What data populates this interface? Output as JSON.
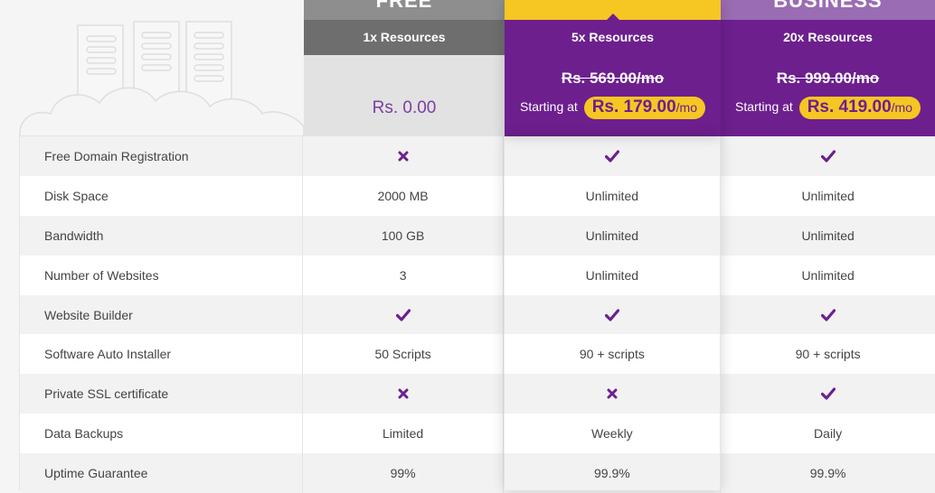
{
  "plans": [
    {
      "title": "FREE",
      "resources": "1x Resources",
      "price": "Rs. 0.00"
    },
    {
      "title": "",
      "resources": "5x Resources",
      "old_price": "Rs. 569.00/mo",
      "starting_label": "Starting at",
      "price": "Rs. 179.00",
      "per": "/mo"
    },
    {
      "title": "BUSINESS",
      "resources": "20x Resources",
      "old_price": "Rs. 999.00/mo",
      "starting_label": "Starting at",
      "price": "Rs. 419.00",
      "per": "/mo"
    }
  ],
  "features": [
    {
      "name": "Free Domain Registration",
      "values": [
        {
          "icon": "cross-icon"
        },
        {
          "icon": "check-icon"
        },
        {
          "icon": "check-icon"
        }
      ]
    },
    {
      "name": "Disk Space",
      "values": [
        {
          "text": "2000 MB"
        },
        {
          "text": "Unlimited"
        },
        {
          "text": "Unlimited"
        }
      ]
    },
    {
      "name": "Bandwidth",
      "values": [
        {
          "text": "100 GB"
        },
        {
          "text": "Unlimited"
        },
        {
          "text": "Unlimited"
        }
      ]
    },
    {
      "name": "Number of Websites",
      "values": [
        {
          "text": "3"
        },
        {
          "text": "Unlimited"
        },
        {
          "text": "Unlimited"
        }
      ]
    },
    {
      "name": "Website Builder",
      "values": [
        {
          "icon": "check-icon"
        },
        {
          "icon": "check-icon"
        },
        {
          "icon": "check-icon"
        }
      ]
    },
    {
      "name": "Software Auto Installer",
      "values": [
        {
          "text": "50 Scripts"
        },
        {
          "text": "90 + scripts"
        },
        {
          "text": "90 + scripts"
        }
      ]
    },
    {
      "name": "Private SSL certificate",
      "values": [
        {
          "icon": "cross-icon"
        },
        {
          "icon": "cross-icon"
        },
        {
          "icon": "check-icon"
        }
      ]
    },
    {
      "name": "Data Backups",
      "values": [
        {
          "text": "Limited"
        },
        {
          "text": "Weekly"
        },
        {
          "text": "Daily"
        }
      ]
    },
    {
      "name": "Uptime Guarantee",
      "values": [
        {
          "text": "99%"
        },
        {
          "text": "99.9%"
        },
        {
          "text": "99.9%"
        }
      ]
    }
  ],
  "colors": {
    "brand_purple": "#6d1f8e",
    "accent_yellow": "#f6c623",
    "free_gray": "#6e6e6e"
  }
}
